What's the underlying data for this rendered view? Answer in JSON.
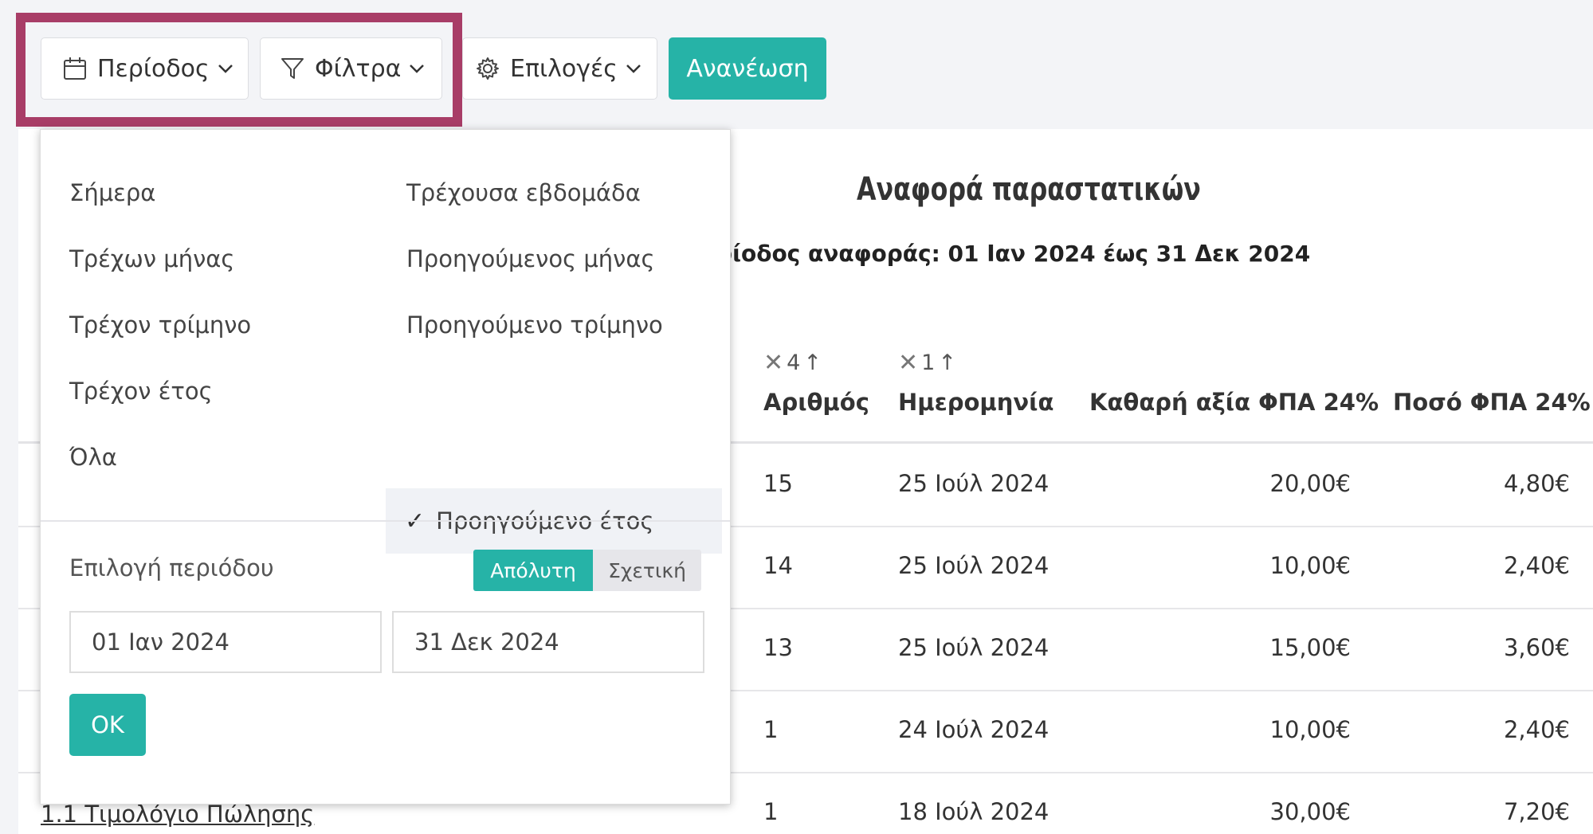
{
  "toolbar": {
    "period_label": "Περίοδος",
    "filters_label": "Φίλτρα",
    "options_label": "Επιλογές",
    "refresh_label": "Ανανέωση"
  },
  "report": {
    "title": "Αναφορά παραστατικών",
    "period_text": "Περίοδος αναφοράς: 01 Ιαν 2024 έως 31 Δεκ 2024"
  },
  "table": {
    "sort": [
      {
        "order": "4"
      },
      {
        "order": "1"
      }
    ],
    "columns": [
      "Αριθμός",
      "Ημερομηνία",
      "Καθαρή αξία ΦΠΑ 24%",
      "Ποσό ΦΠΑ 24%"
    ],
    "rows": [
      {
        "number": "15",
        "date": "25 Ιούλ 2024",
        "net": "20,00€",
        "vat": "4,80€"
      },
      {
        "number": "14",
        "date": "25 Ιούλ 2024",
        "net": "10,00€",
        "vat": "2,40€"
      },
      {
        "number": "13",
        "date": "25 Ιούλ 2024",
        "net": "15,00€",
        "vat": "3,60€"
      },
      {
        "number": "1",
        "date": "24 Ιούλ 2024",
        "net": "10,00€",
        "vat": "2,40€"
      },
      {
        "number": "1",
        "date": "18 Ιούλ 2024",
        "net": "30,00€",
        "vat": "7,20€"
      }
    ],
    "last_doc_link": "1.1 Τιμολόγιο Πώλησης"
  },
  "period_dropdown": {
    "options": [
      "Σήμερα",
      "Τρέχουσα εβδομάδα",
      "Τρέχων μήνας",
      "Προηγούμενος μήνας",
      "Τρέχον τρίμηνο",
      "Προηγούμενο τρίμηνο",
      "Τρέχον έτος",
      "Προηγούμενο έτος",
      "Όλα"
    ],
    "selected": "Προηγούμενο έτος",
    "custom_label": "Επιλογή περιόδου",
    "mode_absolute": "Απόλυτη",
    "mode_relative": "Σχετική",
    "from_date": "01 Ιαν 2024",
    "to_date": "31 Δεκ 2024",
    "ok_label": "OK"
  },
  "colors": {
    "accent": "#26b3a7",
    "highlight_border": "#a83d67"
  }
}
